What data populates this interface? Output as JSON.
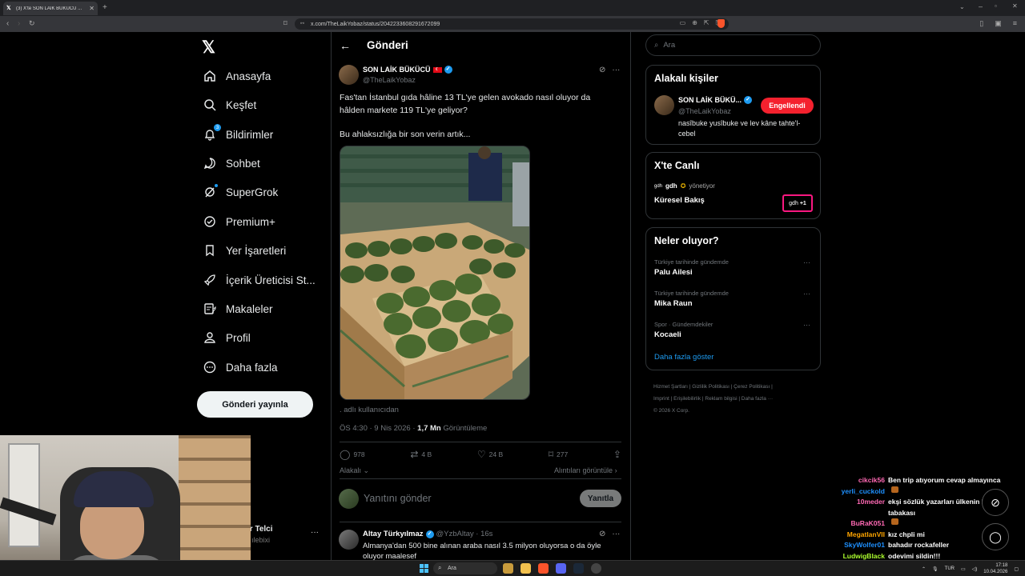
{
  "browser": {
    "tab_title": "(3) X'te SON LAİK BÜKÜCÜ ...",
    "url": "x.com/TheLaikYobaz/status/2042233608291672099"
  },
  "nav": {
    "items": [
      {
        "label": "Anasayfa",
        "icon": "home-icon"
      },
      {
        "label": "Keşfet",
        "icon": "search-icon"
      },
      {
        "label": "Bildirimler",
        "icon": "bell-icon",
        "badge": "3"
      },
      {
        "label": "Sohbet",
        "icon": "chat-icon"
      },
      {
        "label": "SuperGrok",
        "icon": "grok-icon"
      },
      {
        "label": "Premium+",
        "icon": "premium-icon"
      },
      {
        "label": "Yer İşaretleri",
        "icon": "bookmark-icon"
      },
      {
        "label": "İçerik Üreticisi St...",
        "icon": "rocket-icon"
      },
      {
        "label": "Makaleler",
        "icon": "articles-icon"
      },
      {
        "label": "Profil",
        "icon": "profile-icon"
      },
      {
        "label": "Daha fazla",
        "icon": "more-icon"
      }
    ],
    "post_button": "Gönderi yayınla",
    "account_name": "ır Telci",
    "account_handle": "ılebixi"
  },
  "main": {
    "title": "Gönderi",
    "tweet": {
      "author": "SON LAİK BÜKÜCÜ",
      "handle": "@TheLaikYobaz",
      "text1": "Fas'tan İstanbul gıda hâline 13 TL'ye gelen avokado nasıl oluyor da hâlden markete 119 TL'ye geliyor?",
      "text2": "Bu ahlaksızlığa bir son verin artık...",
      "credit": ". adlı kullanıcıdan",
      "time": "ÖS 4:30 · 9 Nis 2026 · ",
      "views": "1,7 Mn",
      "views_label": " Görüntüleme",
      "replies": "978",
      "retweets": "4 B",
      "likes": "24 B",
      "bookmarks": "277",
      "audience": "Alakalı",
      "quotes": "Alıntıları görüntüle"
    },
    "reply_placeholder": "Yanıtını gönder",
    "reply_button": "Yanıtla",
    "reply": {
      "name": "Altay Türkyılmaz",
      "handle": "@YzbAltay · 16s",
      "text": "Almanya'dan 500 bine alınan araba nasıl 3.5 milyon oluyorsa o da öyle oluyor maalesef"
    }
  },
  "right": {
    "search_placeholder": "Ara",
    "related": {
      "title": "Alakalı kişiler",
      "name": "SON LAİK BÜKÜ...",
      "handle": "@TheLaikYobaz",
      "button": "Engellendi",
      "bio": "nasîbuke yusîbuke ve lev kâne tahte'l-cebel"
    },
    "live": {
      "title": "X'te Canlı",
      "host": "gdh",
      "host_role": "yönetiyor",
      "space_title": "Küresel Bakış",
      "avatar_text": "gdh",
      "more_count": "+1"
    },
    "trends": {
      "title": "Neler oluyor?",
      "items": [
        {
          "category": "Türkiye tarihinde gündemde",
          "name": "Palu Ailesi"
        },
        {
          "category": "Türkiye tarihinde gündemde",
          "name": "Mika Raun"
        },
        {
          "category": "Spor · Gündemdekiler",
          "name": "Kocaeli"
        }
      ],
      "show_more": "Daha fazla göster"
    },
    "footer": {
      "line1": "Hizmet Şartları  |  Gizlilik Politikası  |  Çerez Politikası  |",
      "line2": "Imprint  |  Erişilebilirlik  |  Reklam bilgisi  |  Daha fazla ···",
      "line3": "© 2026 X Corp."
    }
  },
  "chat": [
    {
      "user": "cikcik56",
      "color": "#ff69b4",
      "msg": "Ben trip atıyorum cevap almayınca"
    },
    {
      "user": "yerli_cuckold",
      "color": "#1e90ff",
      "msg": "",
      "emote": true
    },
    {
      "user": "10meder",
      "color": "#ff69b4",
      "msg": "ekşi sözlük yazarları ülkenin kaymak"
    },
    {
      "user": "",
      "color": "#ffffff",
      "msg": "tabakası"
    },
    {
      "user": "BuRaK051",
      "color": "#ff69b4",
      "msg": "",
      "emote": true
    },
    {
      "user": "MegatlanVII",
      "color": "#ffa500",
      "msg": "kız chpli mi"
    },
    {
      "user": "SkyWolfer01",
      "color": "#1e90ff",
      "msg": "bahadır rockafeller"
    },
    {
      "user": "LudwigBlack",
      "color": "#adff2f",
      "msg": "odevimi sildin!!!"
    },
    {
      "user": "yerli_cuckold",
      "color": "#1e90ff",
      "msg": "şahsen ceo şu"
    }
  ],
  "taskbar": {
    "search": "Ara",
    "lang": "TUR",
    "time": "17:18",
    "date": "10.04.2026"
  }
}
